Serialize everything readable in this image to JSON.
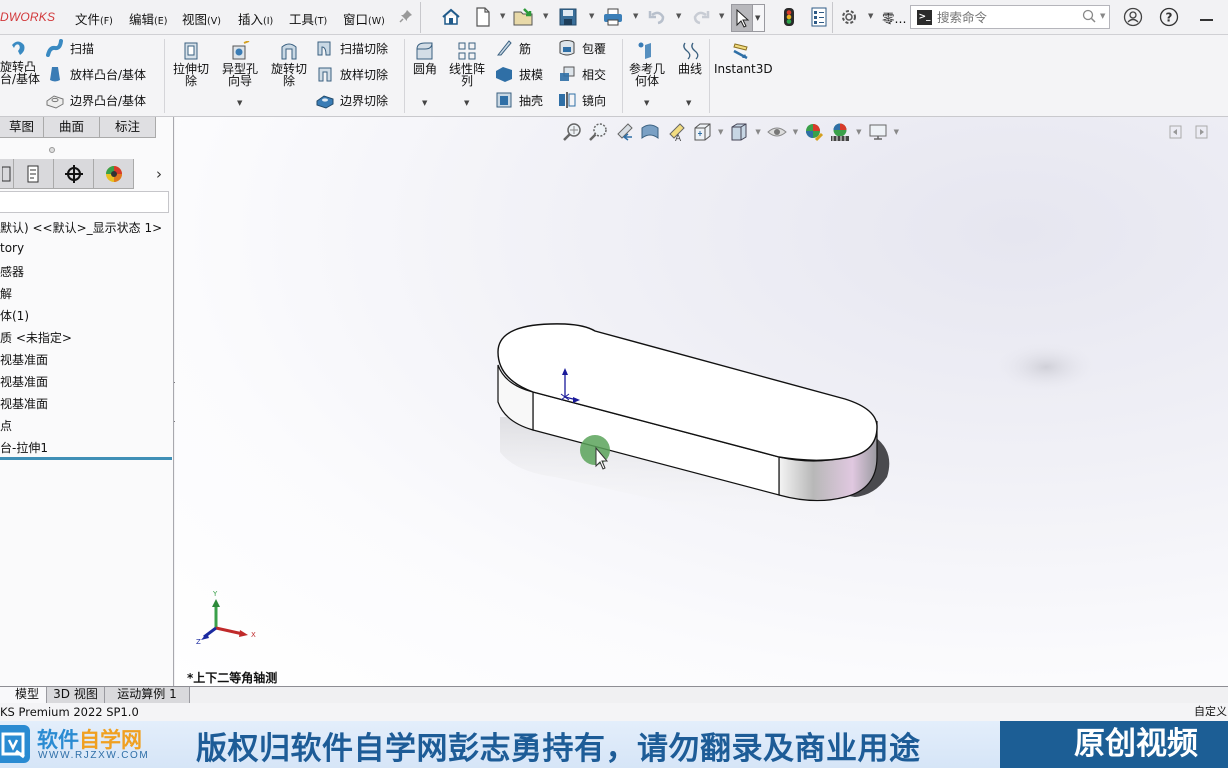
{
  "app": {
    "brand": "DWORKS",
    "menus": [
      {
        "label": "文件",
        "key": "(F)"
      },
      {
        "label": "编辑",
        "key": "(E)"
      },
      {
        "label": "视图",
        "key": "(V)"
      },
      {
        "label": "插入",
        "key": "(I)"
      },
      {
        "label": "工具",
        "key": "(T)"
      },
      {
        "label": "窗口",
        "key": "(W)"
      }
    ],
    "toolbar_truncated_label": "零...",
    "search": {
      "placeholder": "搜索命令",
      "value": ""
    }
  },
  "ribbon": {
    "features_left": {
      "revolve_boss": "旋转凸\n台/基体",
      "sweep": "扫描",
      "loft_boss": "放样凸台/基体",
      "boundary_boss": "边界凸台/基体"
    },
    "cuts": {
      "extruded_cut": "拉伸切\n除",
      "hole_wizard": "异型孔\n向导",
      "revolved_cut": "旋转切\n除",
      "swept_cut": "扫描切除",
      "lofted_cut": "放样切除",
      "boundary_cut": "边界切除"
    },
    "fillet": "圆角",
    "linear_pattern": "线性阵\n列",
    "rib": "筋",
    "draft": "拔模",
    "shell": "抽壳",
    "wrap": "包覆",
    "intersect": "相交",
    "mirror": "镜向",
    "ref_geometry": "参考几\n何体",
    "curves": "曲线",
    "instant3d": "Instant3D"
  },
  "left_panel": {
    "cm_tabs": [
      "草图",
      "曲面",
      "标注"
    ],
    "tree": [
      "默认) <<默认>_显示状态 1>",
      "tory",
      "感器",
      "解",
      "体(1)",
      "质 <未指定>",
      "视基准面",
      "视基准面",
      "视基准面",
      "点",
      "台-拉伸1"
    ]
  },
  "viewport": {
    "view_label": "*上下二等角轴测",
    "triad": {
      "x": "X",
      "y": "Y",
      "z": "Z"
    }
  },
  "bottom_tabs": [
    "模型",
    "3D 视图",
    "运动算例 1"
  ],
  "status": {
    "left": "KS Premium 2022 SP1.0",
    "right": "自定义"
  },
  "banner": {
    "logo_cn_blue": "软件",
    "logo_cn_orange": "自学网",
    "logo_url": "WWW.RJZXW.COM",
    "copyright": "版权归软件自学网彭志勇持有，请勿翻录及商业用途",
    "original": "原创视频"
  },
  "colors": {
    "brand_red": "#d2383a",
    "rollback_blue": "#3f8fb6",
    "banner_blue": "#1c5e95",
    "logo_orange": "#f0a020",
    "cursor_highlight": "#5aa35a"
  }
}
